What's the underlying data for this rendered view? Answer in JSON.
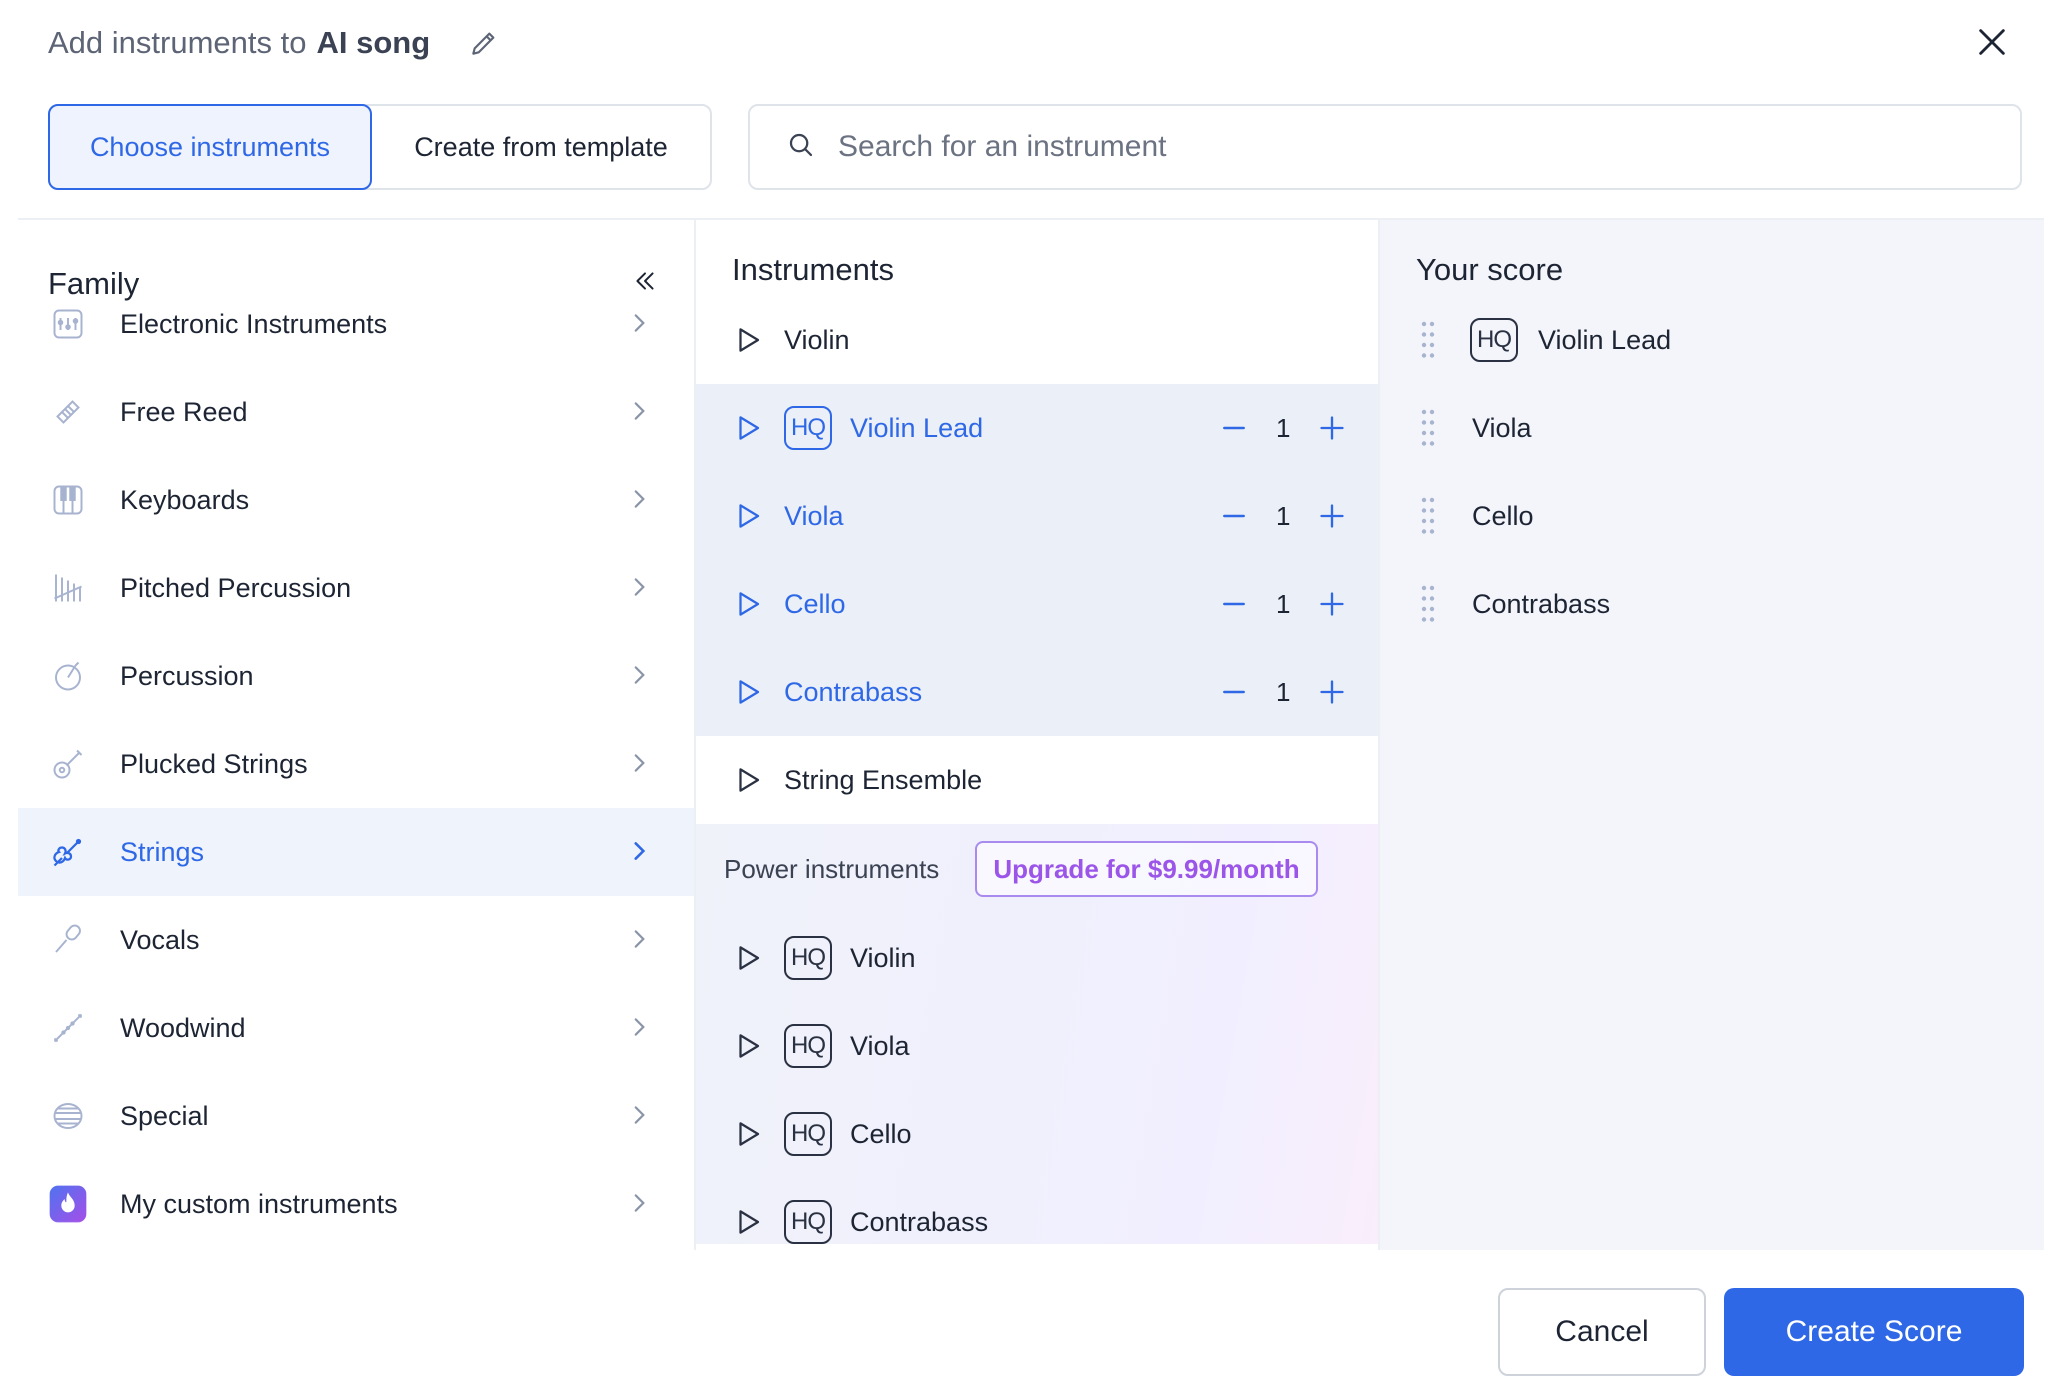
{
  "header": {
    "title_prefix": "Add instruments to",
    "song_name": "AI song",
    "edit_icon": "pencil-icon",
    "close_icon": "close-icon"
  },
  "tabs": {
    "choose": "Choose instruments",
    "template": "Create from template"
  },
  "search": {
    "placeholder": "Search for an instrument",
    "value": ""
  },
  "family": {
    "header": "Family",
    "collapse_icon": "double-chevron-left-icon",
    "items": [
      {
        "label": "Electronic Instruments",
        "icon": "synth-icon"
      },
      {
        "label": "Free Reed",
        "icon": "accordion-icon"
      },
      {
        "label": "Keyboards",
        "icon": "piano-keys-icon"
      },
      {
        "label": "Pitched Percussion",
        "icon": "xylophone-icon"
      },
      {
        "label": "Percussion",
        "icon": "drum-icon"
      },
      {
        "label": "Plucked Strings",
        "icon": "guitar-icon"
      },
      {
        "label": "Strings",
        "icon": "violin-icon",
        "active": true
      },
      {
        "label": "Vocals",
        "icon": "microphone-icon"
      },
      {
        "label": "Woodwind",
        "icon": "flute-icon"
      },
      {
        "label": "Special",
        "icon": "special-icon"
      },
      {
        "label": "My custom instruments",
        "icon": "custom-flame-icon"
      }
    ]
  },
  "instruments": {
    "header": "Instruments",
    "items": [
      {
        "name": "Violin",
        "hq": false,
        "selected": false
      },
      {
        "name": "Violin Lead",
        "hq": true,
        "selected": true,
        "count": "1"
      },
      {
        "name": "Viola",
        "hq": false,
        "selected": true,
        "count": "1"
      },
      {
        "name": "Cello",
        "hq": false,
        "selected": true,
        "count": "1"
      },
      {
        "name": "Contrabass",
        "hq": false,
        "selected": true,
        "count": "1"
      },
      {
        "name": "String Ensemble",
        "hq": false,
        "selected": false
      }
    ],
    "power": {
      "label": "Power instruments",
      "upgrade": "Upgrade for $9.99/month",
      "items": [
        {
          "name": "Violin",
          "hq": true
        },
        {
          "name": "Viola",
          "hq": true
        },
        {
          "name": "Cello",
          "hq": true
        },
        {
          "name": "Contrabass",
          "hq": true
        }
      ]
    },
    "hq_badge": "HQ"
  },
  "score": {
    "header": "Your score",
    "items": [
      {
        "name": "Violin Lead",
        "hq": true
      },
      {
        "name": "Viola",
        "hq": false
      },
      {
        "name": "Cello",
        "hq": false
      },
      {
        "name": "Contrabass",
        "hq": false
      }
    ]
  },
  "footer": {
    "cancel": "Cancel",
    "create": "Create Score"
  },
  "colors": {
    "accent": "#2f68e6",
    "selected_bg": "#ebeff7",
    "upgrade": "#9b55e8"
  }
}
